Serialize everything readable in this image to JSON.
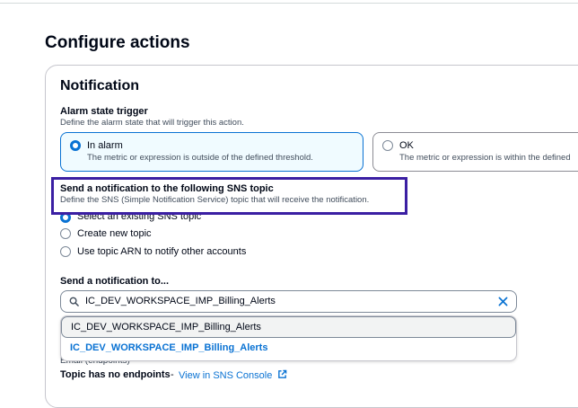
{
  "page": {
    "title": "Configure actions"
  },
  "notification": {
    "section_title": "Notification",
    "alarm_state": {
      "label": "Alarm state trigger",
      "description": "Define the alarm state that will trigger this action.",
      "options": [
        {
          "label": "In alarm",
          "description": "The metric or expression is outside of the defined threshold.",
          "selected": true
        },
        {
          "label": "OK",
          "description": "The metric or expression is within the defined",
          "selected": false
        }
      ]
    },
    "sns": {
      "label": "Send a notification to the following SNS topic",
      "description": "Define the SNS (Simple Notification Service) topic that will receive the notification.",
      "options": [
        {
          "label": "Select an existing SNS topic",
          "selected": true
        },
        {
          "label": "Create new topic",
          "selected": false
        },
        {
          "label": "Use topic ARN to notify other accounts",
          "selected": false
        }
      ]
    },
    "send_to": {
      "label": "Send a notification to...",
      "search_value": "IC_DEV_WORKSPACE_IMP_Billing_Alerts",
      "dropdown_items": [
        "IC_DEV_WORKSPACE_IMP_Billing_Alerts",
        "IC_DEV_WORKSPACE_IMP_Billing_Alerts"
      ]
    },
    "footer": {
      "partial_text": "Email (endpoints)",
      "no_endpoints": "Topic has no endpoints",
      "separator": "-",
      "console_link": "View in SNS Console"
    }
  },
  "colors": {
    "accent": "#0972d3",
    "highlight_border": "#3b1fa3",
    "selected_tile_bg": "#f0fbff"
  },
  "icons": {
    "search": "search-icon",
    "clear": "close-icon",
    "external": "external-link-icon"
  }
}
